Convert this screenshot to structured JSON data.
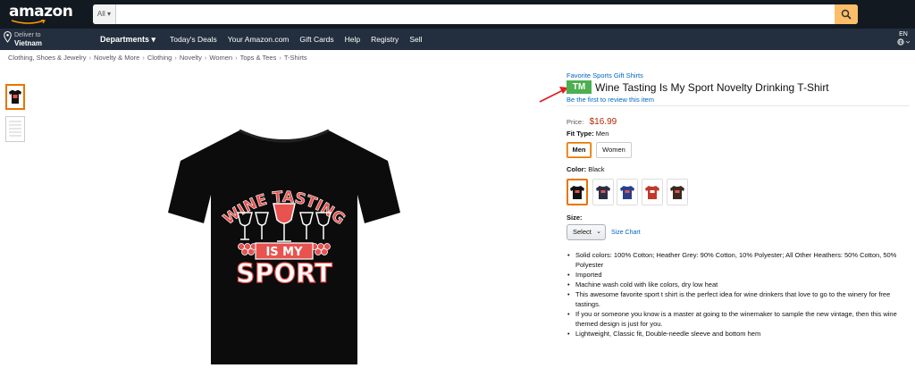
{
  "header": {
    "logo_text": "amazon",
    "search": {
      "category": "All",
      "placeholder": ""
    },
    "deliver_line1": "Deliver to",
    "deliver_line2": "Vietnam",
    "departments_label": "Departments",
    "nav_links": [
      "Today's Deals",
      "Your Amazon.com",
      "Gift Cards",
      "Help",
      "Registry",
      "Sell"
    ],
    "language": "EN"
  },
  "breadcrumb": [
    "Clothing, Shoes & Jewelry",
    "Novelty & More",
    "Clothing",
    "Novelty",
    "Women",
    "Tops & Tees",
    "T-Shirts"
  ],
  "product": {
    "brand": "Favorite Sports Gift Shirts",
    "tm_badge": "TM",
    "title": "Wine Tasting Is My Sport Novelty Drinking T-Shirt",
    "review_link": "Be the first to review this item",
    "price_label": "Price:",
    "price": "$16.99",
    "fit_type_label": "Fit Type:",
    "fit_type_value": "Men",
    "fit_options": [
      "Men",
      "Women"
    ],
    "color_label": "Color:",
    "color_value": "Black",
    "swatch_colors": [
      "#111111",
      "#2b2f45",
      "#27408b",
      "#c0392b",
      "#3b2a20"
    ],
    "size_label": "Size:",
    "size_select": "Select",
    "size_chart": "Size Chart",
    "bullets": [
      "Solid colors: 100% Cotton; Heather Grey: 90% Cotton, 10% Polyester; All Other Heathers: 50% Cotton, 50% Polyester",
      "Imported",
      "Machine wash cold with like colors, dry low heat",
      "This awesome favorite sport t shirt is the perfect idea for wine drinkers that love to go to the winery for free tastings.",
      "If you or someone you know is a master at going to the winemaker to sample the new vintage, then this wine themed design is just for you.",
      "Lightweight, Classic fit, Double-needle sleeve and bottom hem"
    ],
    "design_text": {
      "line1": "WINE TASTING",
      "line2": "IS MY",
      "line3": "SPORT"
    }
  },
  "colors": {
    "nav_dark": "#131921",
    "nav_secondary": "#232f3e",
    "search_button": "#febd69",
    "link": "#0066c0",
    "price": "#b12704",
    "selected_border": "#e77600",
    "tm_badge": "#4caf50",
    "design_red": "#e8524f"
  }
}
